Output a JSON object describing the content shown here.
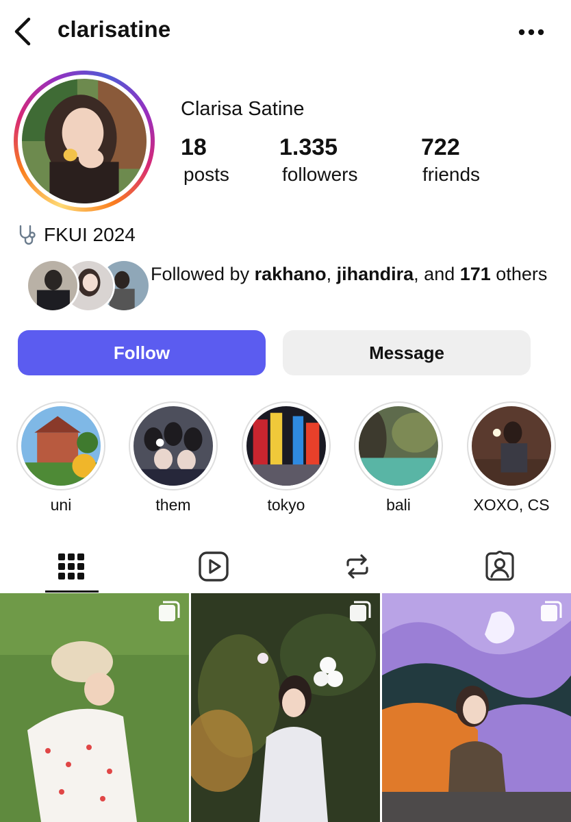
{
  "header": {
    "username": "clarisatine",
    "back_icon": "chevron-left-icon",
    "more_icon": "more-horizontal-icon"
  },
  "profile": {
    "display_name": "Clarisa Satine",
    "stats": {
      "posts": {
        "value": "18",
        "label": "posts"
      },
      "followers": {
        "value": "1.335",
        "label": "followers"
      },
      "friends": {
        "value": "722",
        "label": "friends"
      }
    },
    "bio": {
      "icon": "stethoscope-icon",
      "text": "FKUI 2024"
    }
  },
  "followed_by": {
    "prefix": "Followed by ",
    "user1": "rakhano",
    "sep": ", ",
    "user2": "jihandira",
    "mid": ", and ",
    "count": "171",
    "suffix": " others"
  },
  "buttons": {
    "follow": "Follow",
    "message": "Message"
  },
  "highlights": [
    {
      "label": "uni"
    },
    {
      "label": "them"
    },
    {
      "label": "tokyo"
    },
    {
      "label": "bali"
    },
    {
      "label": "XOXO, CS"
    }
  ],
  "tabs": [
    {
      "icon": "grid-icon",
      "active": true
    },
    {
      "icon": "reels-icon",
      "active": false
    },
    {
      "icon": "reposts-icon",
      "active": false
    },
    {
      "icon": "tagged-icon",
      "active": false
    }
  ],
  "colors": {
    "follow_button": "#5b5cf0",
    "message_button": "#efefef",
    "text": "#111111"
  }
}
